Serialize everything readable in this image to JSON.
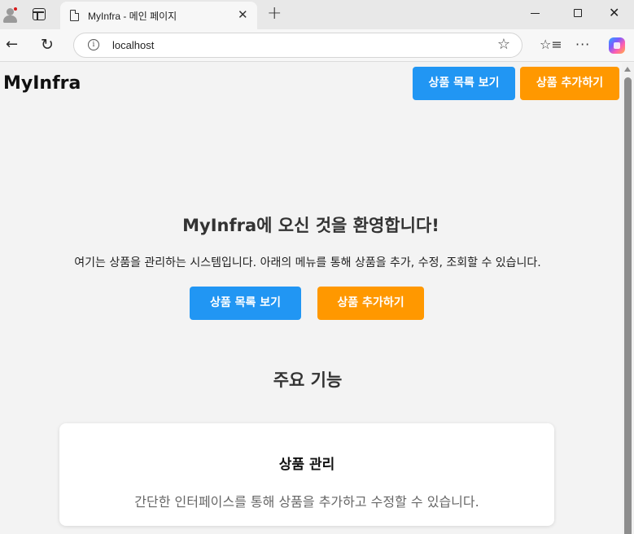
{
  "browser": {
    "tab_title": "MyInfra - 메인 페이지",
    "tab_close": "✕",
    "new_tab": "+",
    "url": "localhost",
    "icons": [
      "profile-icon",
      "tab-actions-icon",
      "page-icon",
      "back-icon",
      "reload-icon",
      "info-icon",
      "favorite-star-icon",
      "favorites-icon",
      "more-icon",
      "copilot-icon",
      "minimize-icon",
      "maximize-icon",
      "close-icon"
    ]
  },
  "header": {
    "logo": "MyInfra",
    "list_button": "상품 목록 보기",
    "add_button": "상품 추가하기"
  },
  "hero": {
    "title": "MyInfra에 오신 것을 환영합니다!",
    "description": "여기는 상품을 관리하는 시스템입니다. 아래의 메뉴를 통해 상품을 추가, 수정, 조회할 수 있습니다.",
    "list_button": "상품 목록 보기",
    "add_button": "상품 추가하기"
  },
  "features": {
    "title": "주요 기능",
    "cards": [
      {
        "title": "상품 관리",
        "description": "간단한 인터페이스를 통해 상품을 추가하고 수정할 수 있습니다."
      }
    ]
  },
  "colors": {
    "primary_blue": "#2196f3",
    "accent_orange": "#ff9800",
    "page_background": "#f3f3f3"
  }
}
